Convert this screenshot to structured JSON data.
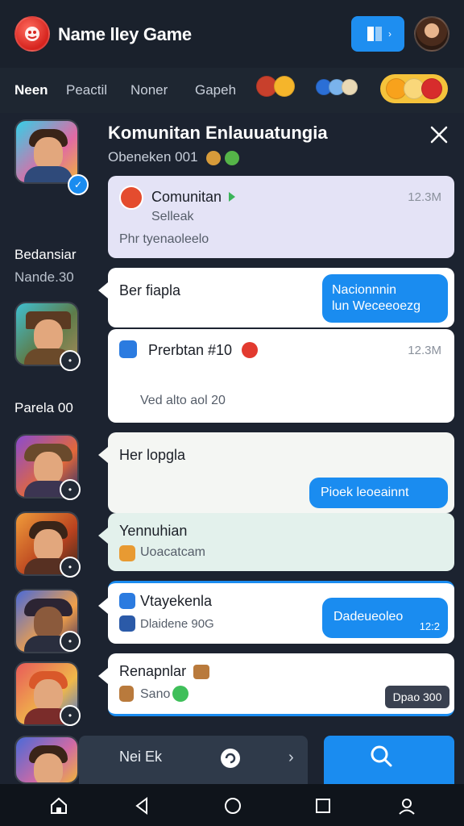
{
  "header": {
    "title": "Name lley Game"
  },
  "tabs": [
    "Neen",
    "Peactil",
    "Noner",
    "Gapeh"
  ],
  "panel": {
    "title": "Komunitan Enlauuatungia",
    "subtitle": "Obeneken 001"
  },
  "side": [
    {
      "label": "Bedansiar",
      "sub": "Nande.30"
    },
    {
      "label": "Parela 00"
    }
  ],
  "cards": {
    "c1": {
      "title": "Comunitan",
      "subtitle": "Selleak",
      "body": "Phr tyenaoleelo",
      "meta": "12.3M"
    },
    "c2": {
      "title": "Ber fiapla",
      "bubble": "Nacionnnin\nlun Weceeoezg"
    },
    "c3": {
      "title": "Prerbtan #10",
      "meta": "12.3M",
      "body": "Ved alto aol 20"
    },
    "c4": {
      "title": "Her lopgla",
      "bubble": "Pioek leoeainnt"
    },
    "c5": {
      "title": "Yennuhian",
      "body": "Uoacatcam"
    },
    "c6": {
      "title": "Vtayekenla",
      "body": "Dlaidene 90G",
      "bubble": "Dadeueoleo",
      "bubble_sub": "12:2"
    },
    "c7": {
      "title": "Renapnlar",
      "body": "Sano",
      "chip": "Dpao 300"
    }
  },
  "bottom": {
    "input": "Nei Ek"
  },
  "icons": {
    "app_logo": "game-logo-icon",
    "action": "edit-icon",
    "close": "close-icon",
    "search": "search-icon",
    "home": "home-icon",
    "back": "back-icon",
    "recent_home": "circle-home-icon",
    "recents": "square-recents-icon",
    "profile": "profile-icon"
  },
  "colors": {
    "accent": "#1a8cf0",
    "background": "#1c2330",
    "card": "#ffffff"
  }
}
